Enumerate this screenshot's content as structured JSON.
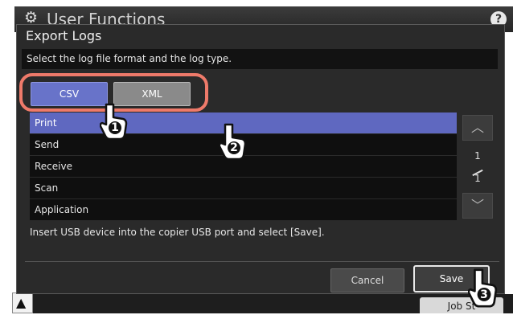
{
  "background": {
    "app_title": "User Functions",
    "help_label": "?",
    "job_status_label": "Job St"
  },
  "dialog": {
    "title": "Export Logs",
    "instruction": "Select the log file format and the log type.",
    "format_buttons": {
      "csv_label": "CSV",
      "xml_label": "XML",
      "selected": "CSV"
    },
    "log_types": [
      {
        "label": "Print",
        "selected": true
      },
      {
        "label": "Send",
        "selected": false
      },
      {
        "label": "Receive",
        "selected": false
      },
      {
        "label": "Scan",
        "selected": false
      },
      {
        "label": "Application",
        "selected": false
      }
    ],
    "pager": {
      "current": "1",
      "total": "1"
    },
    "usb_message": "Insert USB device into the copier USB port and select [Save].",
    "cancel_label": "Cancel",
    "save_label": "Save"
  },
  "callouts": [
    "1",
    "2",
    "3"
  ],
  "colors": {
    "selection": "#5f68c0",
    "csv_button": "#6873c9",
    "highlight_ring": "#ee7a6a"
  }
}
